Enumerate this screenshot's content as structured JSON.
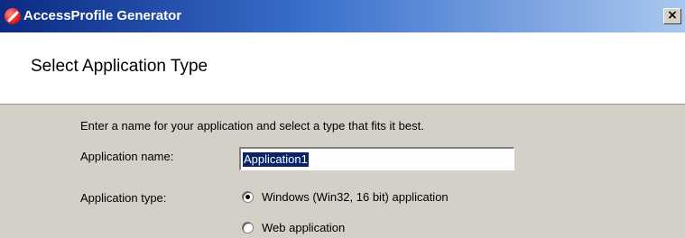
{
  "window": {
    "title": "AccessProfile Generator",
    "icon": "app-icon",
    "close_label": "×"
  },
  "header": {
    "title": "Select Application Type"
  },
  "form": {
    "intro": "Enter a name for your application and select a type that fits it best.",
    "name_label": "Application name:",
    "name_value": "Application1",
    "type_label": "Application type:",
    "type_options": [
      {
        "label": "Windows (Win32, 16 bit) application",
        "selected": true
      },
      {
        "label": "Web application",
        "selected": false
      }
    ]
  },
  "colors": {
    "title_bar_start": "#0b2a83",
    "title_bar_end": "#a9c8ef",
    "dialog_background": "#d4d0c8",
    "header_background": "#ffffff",
    "selection_highlight": "#0a246a"
  }
}
